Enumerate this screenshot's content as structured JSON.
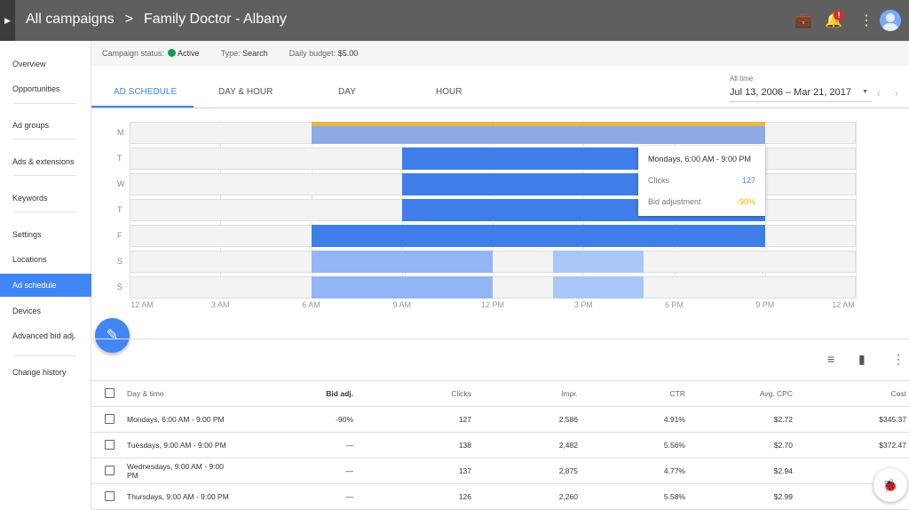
{
  "header": {
    "breadcrumb": [
      "All campaigns",
      "Family Doctor - Albany"
    ],
    "separator": ">",
    "notification_badge": "!"
  },
  "sidebar": {
    "items": [
      {
        "label": "Overview"
      },
      {
        "label": "Opportunities"
      },
      {
        "label": "Ad groups"
      },
      {
        "label": "Ads & extensions"
      },
      {
        "label": "Keywords"
      },
      {
        "label": "Settings"
      },
      {
        "label": "Locations"
      },
      {
        "label": "Ad schedule",
        "active": true
      },
      {
        "label": "Devices"
      },
      {
        "label": "Advanced bid adj."
      },
      {
        "label": "Change history"
      }
    ]
  },
  "status_bar": {
    "status_label": "Campaign status:",
    "status_value": "Active",
    "status_color": "#0f9d58",
    "type_label": "Type:",
    "type_value": "Search",
    "budget_label": "Daily budget:",
    "budget_value": "$5.00"
  },
  "tabs": [
    {
      "label": "AD SCHEDULE",
      "active": true
    },
    {
      "label": "DAY & HOUR"
    },
    {
      "label": "DAY"
    },
    {
      "label": "HOUR"
    }
  ],
  "date_range": {
    "label": "All time",
    "value": "Jul 13, 2006 – Mar 21, 2017"
  },
  "schedule": {
    "days": [
      "M",
      "T",
      "W",
      "T",
      "F",
      "S",
      "S"
    ],
    "x_ticks": [
      "12 AM",
      "3 AM",
      "6 AM",
      "9 AM",
      "12 PM",
      "3 PM",
      "6 PM",
      "9 PM",
      "12 AM"
    ],
    "blocks": [
      {
        "day": 0,
        "start": 6,
        "end": 21,
        "color": "#8eabe3",
        "highlight": "#e5b94b"
      },
      {
        "day": 1,
        "start": 9,
        "end": 21,
        "color": "#3f7ee8"
      },
      {
        "day": 2,
        "start": 9,
        "end": 21,
        "color": "#3f7ee8"
      },
      {
        "day": 3,
        "start": 9,
        "end": 21,
        "color": "#3f7ee8"
      },
      {
        "day": 4,
        "start": 6,
        "end": 21,
        "color": "#3f7ee8"
      },
      {
        "day": 5,
        "start": 6,
        "end": 12,
        "color": "#92b6f5"
      },
      {
        "day": 5,
        "start": 14,
        "end": 17,
        "color": "#aac6f7"
      },
      {
        "day": 6,
        "start": 6,
        "end": 12,
        "color": "#92b6f5"
      },
      {
        "day": 6,
        "start": 14,
        "end": 17,
        "color": "#aac6f7"
      }
    ]
  },
  "tooltip": {
    "title": "Mondays, 6:00 AM - 9:00 PM",
    "clicks_label": "Clicks",
    "clicks_value": "127",
    "bid_label": "Bid adjustment",
    "bid_value": "-90%",
    "clicks_color": "#4285f4",
    "bid_color": "#f4b400"
  },
  "table": {
    "columns": [
      "Day & time",
      "Bid adj.",
      "Clicks",
      "Impr.",
      "CTR",
      "Avg. CPC",
      "Cost"
    ],
    "rows": [
      [
        "Mondays, 6:00 AM - 9:00 PM",
        "-90%",
        "127",
        "2,586",
        "4.91%",
        "$2.72",
        "$345.37"
      ],
      [
        "Tuesdays, 9:00 AM - 9:00 PM",
        "—",
        "138",
        "2,482",
        "5.56%",
        "$2.70",
        "$372.47"
      ],
      [
        "Wednesdays, 9:00 AM - 9:00 PM",
        "—",
        "137",
        "2,875",
        "4.77%",
        "$2.94",
        ""
      ],
      [
        "Thursdays, 9:00 AM - 9:00 PM",
        "—",
        "126",
        "2,260",
        "5.58%",
        "$2.99",
        ""
      ]
    ]
  }
}
